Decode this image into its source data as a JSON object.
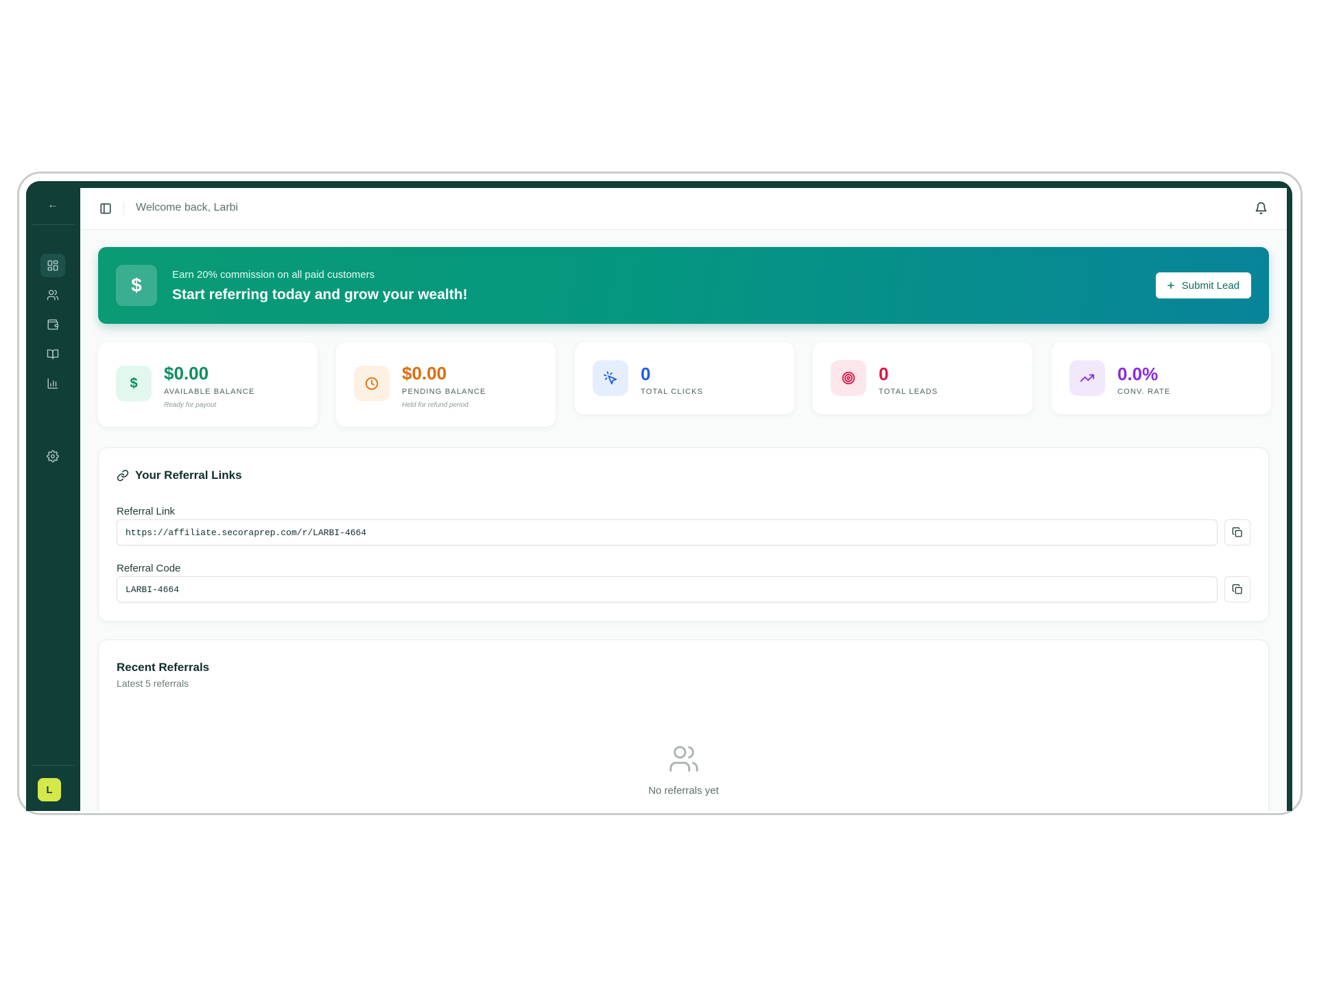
{
  "topbar": {
    "welcome": "Welcome back, Larbi"
  },
  "sidebar": {
    "back_symbol": "←",
    "items": [
      {
        "name": "dashboard",
        "icon": "dashboard-icon",
        "active": true
      },
      {
        "name": "referrals",
        "icon": "users-icon",
        "active": false
      },
      {
        "name": "wallet",
        "icon": "wallet-icon",
        "active": false
      },
      {
        "name": "resources",
        "icon": "book-icon",
        "active": false
      },
      {
        "name": "analytics",
        "icon": "bar-chart-icon",
        "active": false
      }
    ],
    "settings_icon": "gear-icon",
    "avatar_initial": "L"
  },
  "banner": {
    "icon_symbol": "$",
    "subtitle": "Earn 20% commission on all paid customers",
    "title": "Start referring today and grow your wealth!",
    "button_label": "Submit Lead"
  },
  "stats": [
    {
      "value": "$0.00",
      "label": "AVAILABLE BALANCE",
      "note": "Ready for payout",
      "color": "#0b8f5c",
      "icon": "dollar-icon"
    },
    {
      "value": "$0.00",
      "label": "PENDING BALANCE",
      "note": "Held for refund period",
      "color": "#dd6b0c",
      "icon": "clock-icon"
    },
    {
      "value": "0",
      "label": "TOTAL CLICKS",
      "color": "#1d5fe0",
      "icon": "cursor-click-icon"
    },
    {
      "value": "0",
      "label": "TOTAL LEADS",
      "color": "#db1646",
      "icon": "target-icon"
    },
    {
      "value": "0.0%",
      "label": "CONV. RATE",
      "color": "#8a2be2",
      "icon": "trending-up-icon"
    }
  ],
  "referral": {
    "title": "Your Referral Links",
    "link_label": "Referral Link",
    "link_value": "https://affiliate.secoraprep.com/r/LARBI-4664",
    "code_label": "Referral Code",
    "code_value": "LARBI-4664"
  },
  "recent": {
    "title": "Recent Referrals",
    "subtitle": "Latest 5 referrals",
    "empty_text": "No referrals yet"
  }
}
